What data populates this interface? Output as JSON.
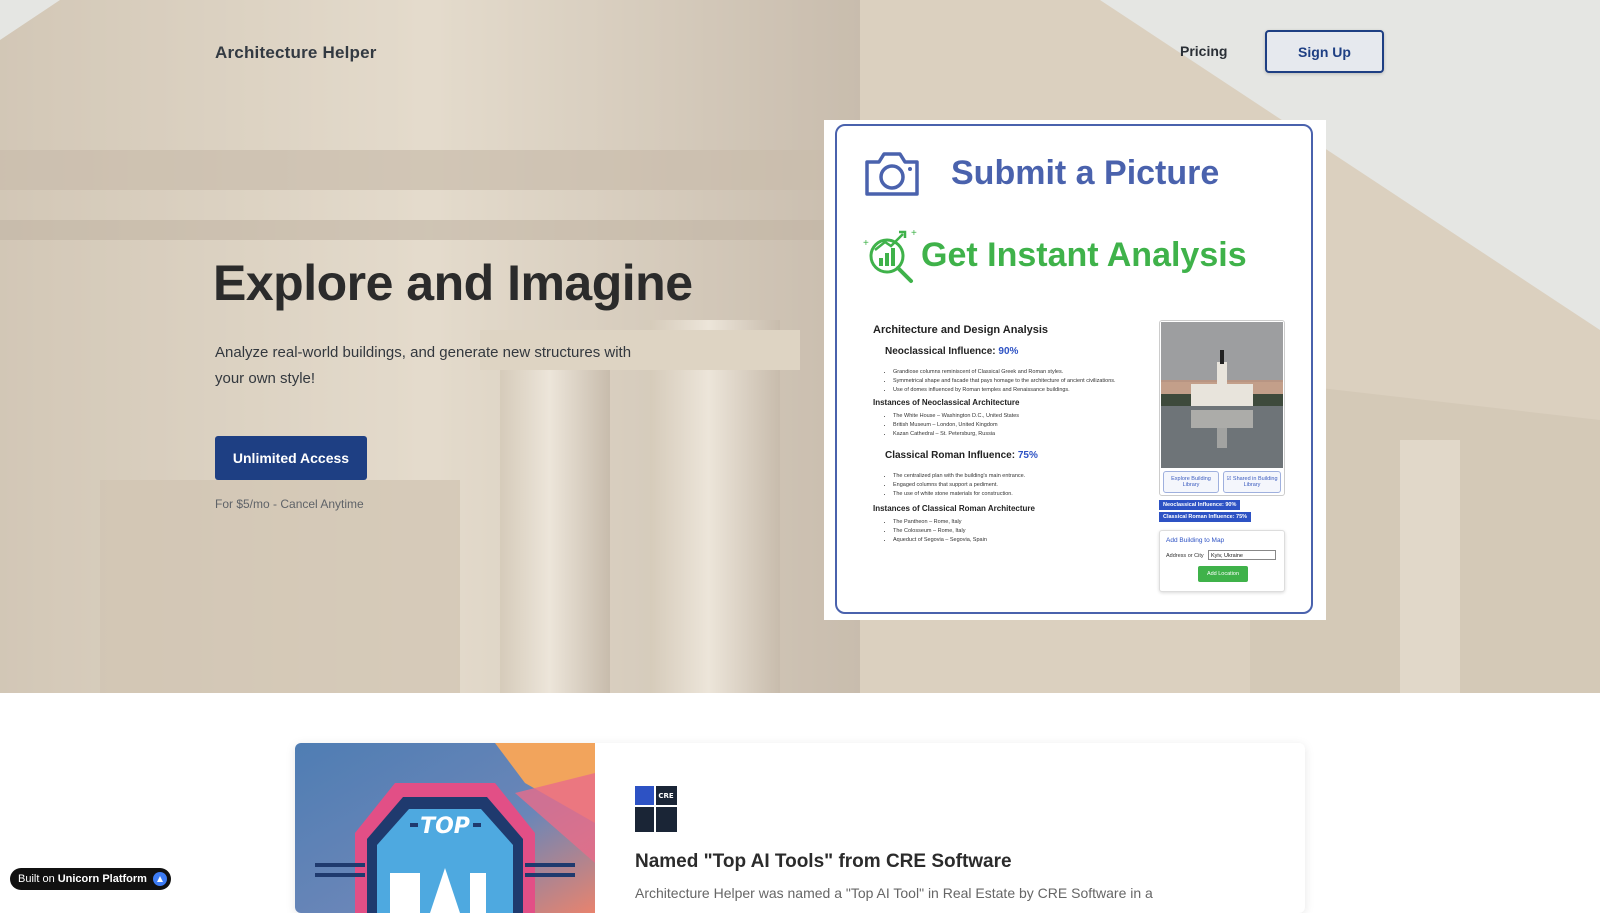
{
  "nav": {
    "brand": "Architecture Helper",
    "pricing": "Pricing",
    "signup": "Sign Up"
  },
  "hero": {
    "title": "Explore and Imagine",
    "subtitle": "Analyze real-world buildings, and generate new structures with your own style!",
    "cta": "Unlimited Access",
    "price_note": "For $5/mo - Cancel Anytime"
  },
  "preview": {
    "submit": "Submit a Picture",
    "instant": "Get Instant Analysis",
    "doc_title": "Architecture and Design Analysis",
    "neo_label": "Neoclassical Influence: ",
    "neo_pct": "90%",
    "neo_points": [
      "Grandiose columns reminiscent of Classical Greek and Roman styles.",
      "Symmetrical shape and facade that pays homage to the architecture of ancient civilizations.",
      "Use of domes influenced by Roman temples and Renaissance buildings."
    ],
    "neo_instances_title": "Instances of Neoclassical Architecture",
    "neo_instances": [
      "The White House – Washington D.C., United States",
      "British Museum – London, United Kingdom",
      "Kazan Cathedral – St. Petersburg, Russia"
    ],
    "roman_label": "Classical Roman Influence: ",
    "roman_pct": "75%",
    "roman_points": [
      "The centralized plan with the building's main entrance.",
      "Engaged columns that support a pediment.",
      "The use of white stone materials for construction."
    ],
    "roman_instances_title": "Instances of Classical Roman Architecture",
    "roman_instances": [
      "The Pantheon – Rome, Italy",
      "The Colosseum – Rome, Italy",
      "Aqueduct of Segovia – Segovia, Spain"
    ],
    "btn_explore": "Explore Building Library",
    "btn_shared": "☑ Shared in Building Library",
    "tag_neo": "Neoclassical Influence: 90%",
    "tag_roman": "Classical Roman Influence: 75%",
    "map_title": "Add Building to Map",
    "map_label": "Address or City",
    "map_value": "Kyiv, Ukraine",
    "map_button": "Add Location"
  },
  "feature": {
    "img_text": "TOP",
    "logo_text": "CRE",
    "title": "Named \"Top AI Tools\" from CRE Software",
    "text": "Architecture Helper was named a \"Top AI Tool\" in Real Estate by CRE Software in a"
  },
  "badge": {
    "prefix": "Built on",
    "name": "Unicorn Platform"
  },
  "colors": {
    "primary": "#1e3f83",
    "preview_blue": "#4a62ad",
    "preview_green": "#3fb24a"
  },
  "icons": [
    "camera-icon",
    "analysis-chart-icon",
    "cre-logo-icon",
    "unicorn-icon"
  ]
}
